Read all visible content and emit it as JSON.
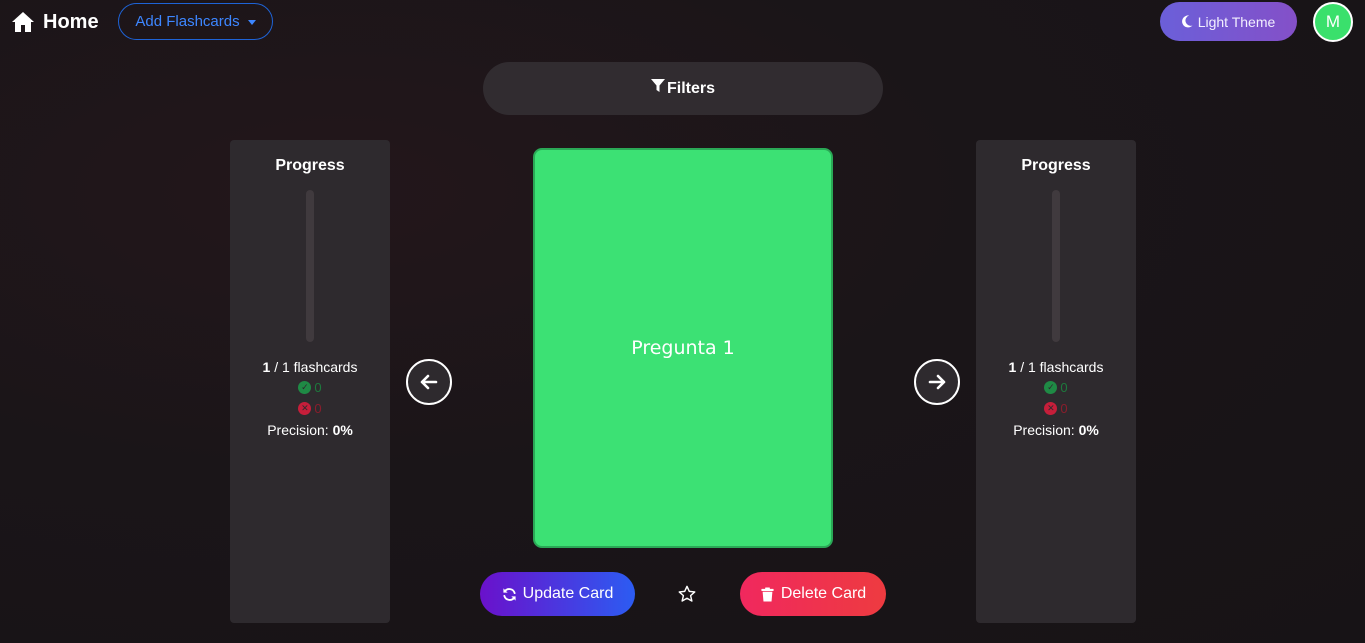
{
  "nav": {
    "home_label": "Home",
    "add_flashcards_label": "Add Flashcards",
    "theme_label": "Light Theme",
    "avatar_initial": "M"
  },
  "filters": {
    "label": "Filters"
  },
  "left_panel": {
    "title": "Progress",
    "current": "1",
    "count_suffix": " / 1 flashcards",
    "correct": "0",
    "wrong": "0",
    "precision_label": "Precision: ",
    "precision_value": "0%",
    "progress_fraction": 0
  },
  "right_panel": {
    "title": "Progress",
    "current": "1",
    "count_suffix": " / 1 flashcards",
    "correct": "0",
    "wrong": "0",
    "precision_label": "Precision: ",
    "precision_value": "0%",
    "progress_fraction": 0
  },
  "card": {
    "text": "Pregunta 1",
    "color": "#3ce174"
  },
  "actions": {
    "update_label": "Update Card",
    "delete_label": "Delete Card"
  },
  "icons": {
    "home": "home-icon",
    "caret": "caret-down-icon",
    "theme": "moon-icon",
    "filter": "filter-icon",
    "prev": "arrow-left-icon",
    "next": "arrow-right-icon",
    "update": "sync-icon",
    "star": "star-outline-icon",
    "delete": "trash-icon",
    "correct": "check-circle-icon",
    "wrong": "x-circle-icon"
  },
  "colors": {
    "accent_blue": "#3d86ff",
    "success": "#1f8a45",
    "danger": "#c61e3a",
    "theme_gradient_start": "#6b5fd9",
    "theme_gradient_end": "#8450c8",
    "update_gradient_start": "#6a11cb",
    "update_gradient_end": "#2c5cf2",
    "delete_gradient_start": "#f0285e",
    "delete_gradient_end": "#ee3b40"
  }
}
